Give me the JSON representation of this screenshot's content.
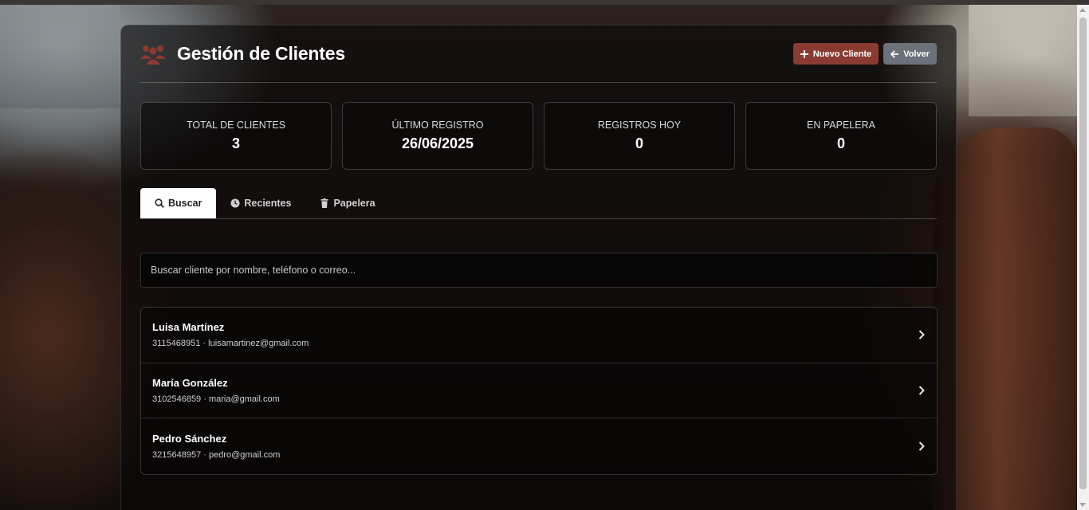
{
  "header": {
    "title": "Gestión de Clientes",
    "icon": "users-icon",
    "accent_color": "#8a3b31",
    "new_client_label": "Nuevo Cliente",
    "back_label": "Volver"
  },
  "stats": [
    {
      "label": "Total de clientes",
      "value": "3"
    },
    {
      "label": "Último registro",
      "value": "26/06/2025"
    },
    {
      "label": "Registros hoy",
      "value": "0"
    },
    {
      "label": "En papelera",
      "value": "0"
    }
  ],
  "tabs": [
    {
      "label": "Buscar",
      "icon": "search-icon",
      "active": true
    },
    {
      "label": "Recientes",
      "icon": "clock-icon",
      "active": false
    },
    {
      "label": "Papelera",
      "icon": "trash-icon",
      "active": false
    }
  ],
  "search": {
    "placeholder": "Buscar cliente por nombre, teléfono o correo...",
    "value": ""
  },
  "clients": [
    {
      "name": "Luisa Martínez",
      "details": "3115468951 · luisamartinez@gmail.com"
    },
    {
      "name": "María González",
      "details": "3102546859 · maria@gmail.com"
    },
    {
      "name": "Pedro Sánchez",
      "details": "3215648957 · pedro@gmail.com"
    }
  ]
}
